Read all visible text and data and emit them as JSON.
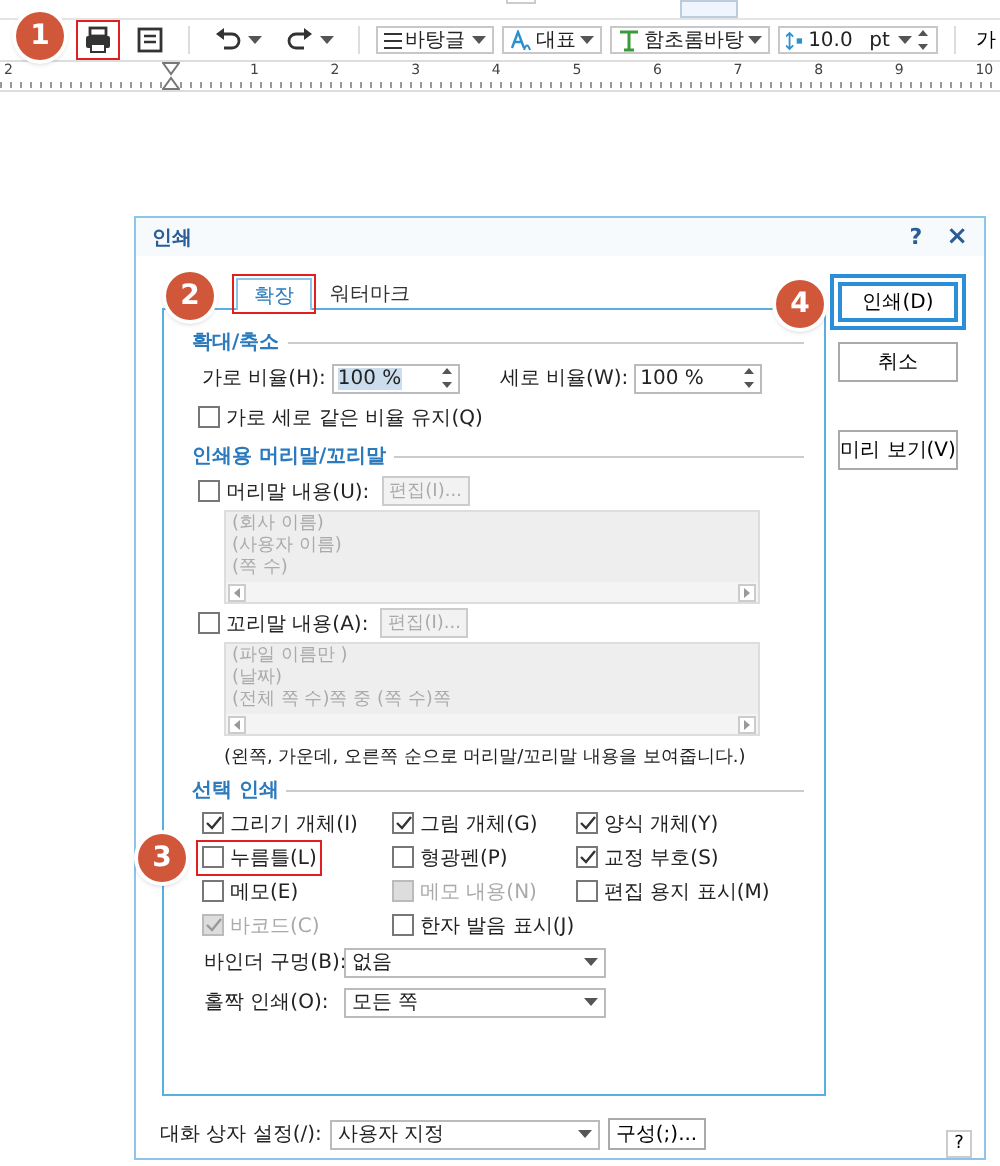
{
  "toolbar": {
    "buttons": [
      {
        "kind": "print",
        "highlighted": true
      },
      {
        "kind": "page",
        "highlighted": false
      },
      {
        "kind": "undo",
        "highlighted": false
      },
      {
        "kind": "redo",
        "highlighted": false
      }
    ],
    "style_box": "바탕글",
    "char_shape_box": "대표",
    "font_box": "함초롬바탕",
    "size_box": {
      "value": "10.0",
      "unit": "pt"
    },
    "char_button": "가"
  },
  "ruler": {
    "labels": [
      "2",
      "1",
      "2",
      "3",
      "4",
      "5",
      "6",
      "7",
      "8",
      "9",
      "10"
    ]
  },
  "dialog": {
    "title": "인쇄",
    "help": "?",
    "close": "×",
    "tabs": [
      {
        "label": "확장",
        "selected": true,
        "highlighted": true
      },
      {
        "label": "워터마크",
        "selected": false,
        "highlighted": false
      }
    ],
    "zoom_section": {
      "title": "확대/축소",
      "fields": [
        {
          "label": "가로 비율(H):",
          "value": "100 %"
        },
        {
          "label": "세로 비율(W):",
          "value": "100 %"
        }
      ],
      "keep_ratio": {
        "label": "가로 세로 같은 비율 유지(Q)",
        "checked": false
      }
    },
    "header_footer_section": {
      "title": "인쇄용 머리말/꼬리말",
      "items": [
        {
          "label": "머리말 내용(U):",
          "checked": false,
          "edit_button": "편집(I)...",
          "preview": [
            "(회사 이름)",
            "(사용자 이름)",
            "(쪽 수)"
          ]
        },
        {
          "label": "꼬리말 내용(A):",
          "checked": false,
          "edit_button": "편집(I)...",
          "preview": [
            "(파일 이름만 )",
            "(날짜)",
            "(전체 쪽 수)쪽 중 (쪽 수)쪽"
          ]
        }
      ],
      "note": "(왼쪽, 가운데, 오른쪽 순으로 머리말/꼬리말 내용을 보여줍니다.)"
    },
    "selection_section": {
      "title": "선택 인쇄",
      "options": [
        {
          "label": "그리기 개체(I)",
          "checked": true,
          "disabled": false,
          "highlighted": false
        },
        {
          "label": "그림 개체(G)",
          "checked": true,
          "disabled": false,
          "highlighted": false
        },
        {
          "label": "양식 개체(Y)",
          "checked": true,
          "disabled": false,
          "highlighted": false
        },
        {
          "label": "누름틀(L)",
          "checked": false,
          "disabled": false,
          "highlighted": true
        },
        {
          "label": "형광펜(P)",
          "checked": false,
          "disabled": false,
          "highlighted": false
        },
        {
          "label": "교정 부호(S)",
          "checked": true,
          "disabled": false,
          "highlighted": false
        },
        {
          "label": "메모(E)",
          "checked": false,
          "disabled": false,
          "highlighted": false
        },
        {
          "label": "메모 내용(N)",
          "checked": false,
          "disabled": true,
          "highlighted": false
        },
        {
          "label": "편집 용지 표시(M)",
          "checked": false,
          "disabled": false,
          "highlighted": false
        },
        {
          "label": "바코드(C)",
          "checked": true,
          "disabled": true,
          "highlighted": false
        },
        {
          "label": "한자 발음 표시(J)",
          "checked": false,
          "disabled": false,
          "highlighted": false
        }
      ],
      "dropdowns": [
        {
          "label": "바인더 구멍(B):",
          "value": "없음"
        },
        {
          "label": "홀짝 인쇄(O):",
          "value": "모든 쪽"
        }
      ]
    },
    "buttons": [
      {
        "label": "인쇄(D)",
        "default": true,
        "highlighted": true
      },
      {
        "label": "취소",
        "default": false,
        "highlighted": false
      },
      {
        "label": "미리 보기(V)",
        "default": false,
        "highlighted": false
      }
    ],
    "dialog_settings": {
      "label": "대화 상자 설정(/):",
      "value": "사용자 지정",
      "button": "구성(;)...",
      "help": "?"
    }
  },
  "annotations": [
    {
      "label": "1"
    },
    {
      "label": "2"
    },
    {
      "label": "3"
    },
    {
      "label": "4"
    }
  ]
}
